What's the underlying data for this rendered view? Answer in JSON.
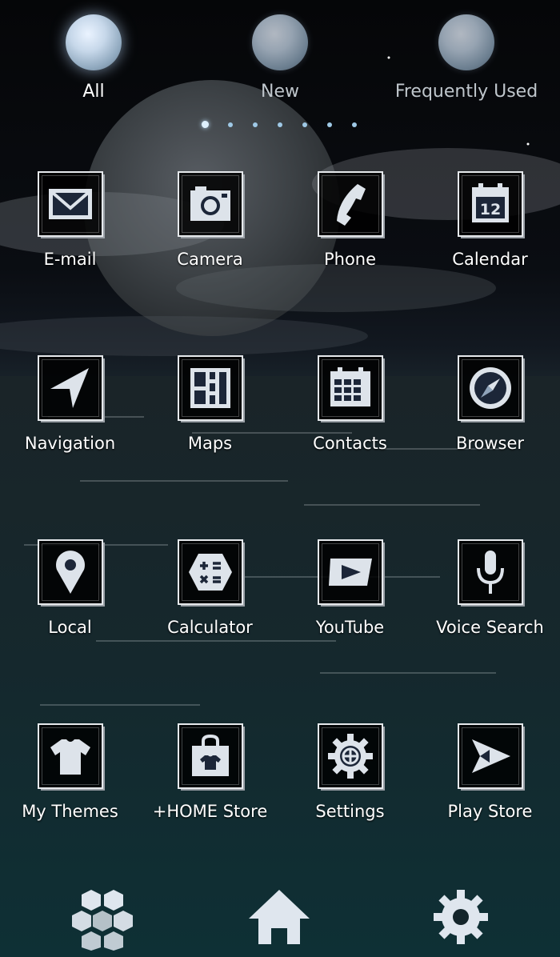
{
  "tabs": [
    {
      "label": "All",
      "active": true
    },
    {
      "label": "New",
      "active": false
    },
    {
      "label": "Frequently Used",
      "active": false
    }
  ],
  "pager": {
    "pages": 7,
    "current": 1
  },
  "apps": [
    {
      "label": "E-mail",
      "icon": "envelope-icon"
    },
    {
      "label": "Camera",
      "icon": "camera-icon"
    },
    {
      "label": "Phone",
      "icon": "phone-handset-icon"
    },
    {
      "label": "Calendar",
      "icon": "calendar-12-icon",
      "badge": "12"
    },
    {
      "label": "Navigation",
      "icon": "navigation-arrow-icon"
    },
    {
      "label": "Maps",
      "icon": "map-grid-icon"
    },
    {
      "label": "Contacts",
      "icon": "contacts-grid-icon"
    },
    {
      "label": "Browser",
      "icon": "compass-icon"
    },
    {
      "label": "Local",
      "icon": "location-pin-icon"
    },
    {
      "label": "Calculator",
      "icon": "calculator-icon"
    },
    {
      "label": "YouTube",
      "icon": "youtube-play-icon"
    },
    {
      "label": "Voice Search",
      "icon": "microphone-icon"
    },
    {
      "label": "My Themes",
      "icon": "tshirt-icon"
    },
    {
      "label": "+HOME Store",
      "icon": "shopping-bag-icon"
    },
    {
      "label": "Settings",
      "icon": "gear-icon"
    },
    {
      "label": "Play Store",
      "icon": "play-flag-icon"
    }
  ],
  "dock": [
    {
      "name": "hexagon-apps-icon"
    },
    {
      "name": "home-icon"
    },
    {
      "name": "settings-gear-icon"
    }
  ],
  "colors": {
    "icon_fill": "#dde3ea",
    "icon_dark": "#1c2638",
    "frame": "#e6e9ec",
    "accent": "#9fc9e6"
  }
}
